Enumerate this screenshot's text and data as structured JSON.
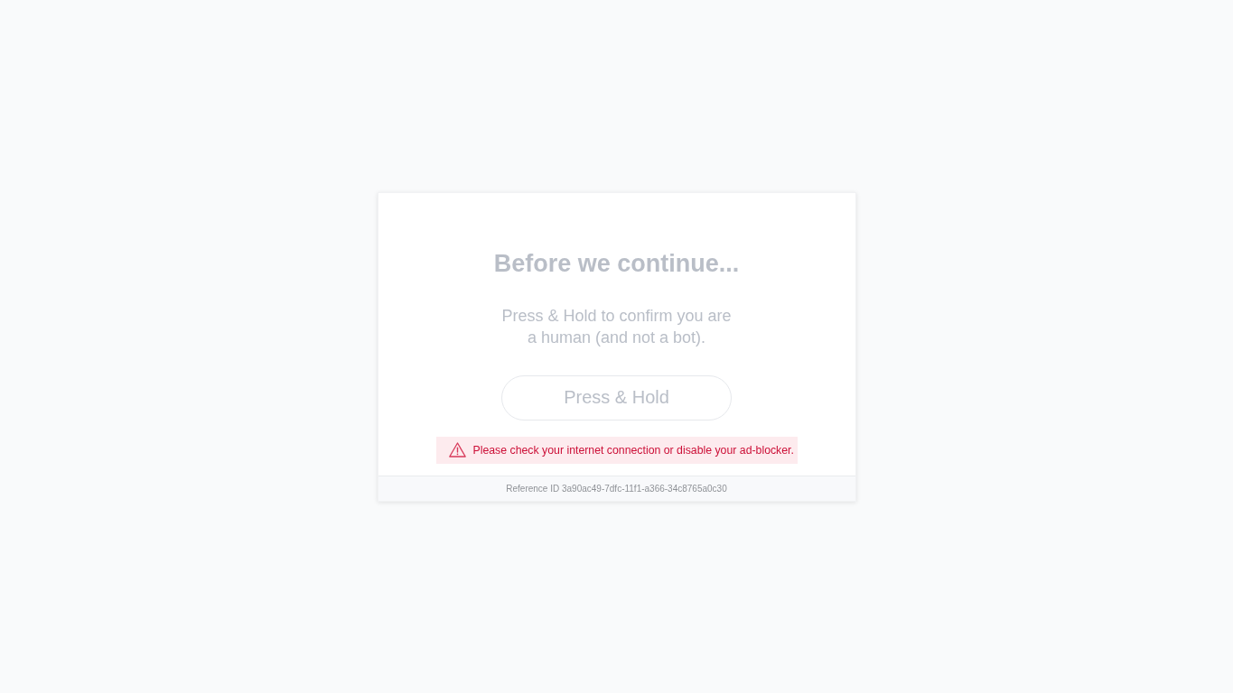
{
  "challenge": {
    "title": "Before we continue...",
    "message": "Press & Hold to confirm you are a human (and not a bot).",
    "button": {
      "label": "Press & Hold"
    },
    "disabled": true
  },
  "error": {
    "text": "Please check your internet connection or disable your ad-blocker."
  },
  "footer": {
    "reference": "Reference ID 3a90ac49-7dfc-11f1-a366-34c8765a0c30"
  }
}
